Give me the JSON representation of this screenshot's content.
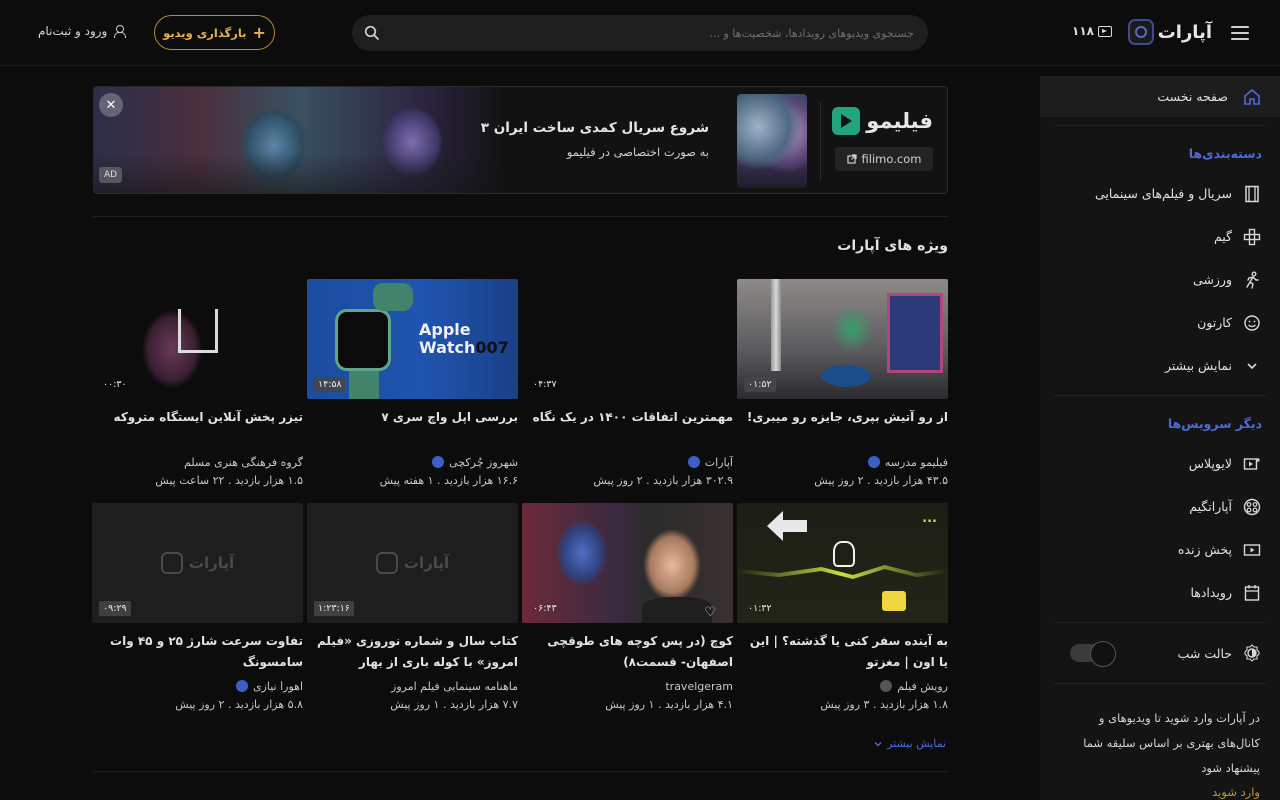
{
  "header": {
    "logo_text": "آپارات",
    "notif_count": "۱۱۸",
    "search_placeholder": "جستجوی ویدیوهای رویدادها، شخصیت‌ها و ...",
    "upload_label": "بارگذاری ویدیو",
    "login_label": "ورود و ثبت‌نام"
  },
  "banner": {
    "title": "شروع سریال کمدی ساخت ایران ۳",
    "subtitle": "به صورت اختصاصی در فیلیمو",
    "brand": "فیلیمو",
    "link": "filimo.com",
    "ad_tag": "AD",
    "close": "✕"
  },
  "sidebar": {
    "home": "صفحه نخست",
    "categories_heading": "دسته‌بندی‌ها",
    "categories": [
      {
        "label": "سریال و فیلم‌های سینمایی",
        "icon": "film-icon"
      },
      {
        "label": "گیم",
        "icon": "gamepad-icon"
      },
      {
        "label": "ورزشی",
        "icon": "runner-icon"
      },
      {
        "label": "کارتون",
        "icon": "smiley-icon"
      },
      {
        "label": "نمایش بیشتر",
        "icon": "chevron-down-icon"
      }
    ],
    "services_heading": "دیگر سرویس‌ها",
    "services": [
      {
        "label": "لایوپلاس",
        "icon": "live-plus-icon"
      },
      {
        "label": "آپاراتگیم",
        "icon": "aparat-game-icon"
      },
      {
        "label": "پخش زنده",
        "icon": "live-icon"
      },
      {
        "label": "رویدادها",
        "icon": "calendar-icon"
      }
    ],
    "night_mode": "حالت شب",
    "note": "در آپارات وارد شوید تا ویدیوهای و کانال‌های بهتری بر اساس سلیقه شما پیشنهاد شود",
    "login": "وارد شوید"
  },
  "section": {
    "title": "ویژه های آپارات",
    "more": "نمایش بیشتر"
  },
  "videos": [
    [
      {
        "title": "از رو آتیش بپری، جایزه رو میبری!",
        "channel": "فیلیمو مدرسه",
        "verified": true,
        "views": "۴۳.۵ هزار بازدید",
        "age": "۲ روز پیش",
        "duration": "۰۱:۵۲"
      },
      {
        "title": "مهمترین اتفاقات ۱۴۰۰ در یک نگاه",
        "channel": "آپارات",
        "verified": true,
        "views": "۳۰۲.۹ هزار بازدید",
        "age": "۲ روز پیش",
        "duration": "۰۴:۳۷"
      },
      {
        "title": "بررسی اپل واچ سری ۷",
        "channel": "شهروز چُرکچی",
        "verified": true,
        "views": "۱۶.۶ هزار بازدید",
        "age": "۱ هفته پیش",
        "duration": "۱۴:۵۸"
      },
      {
        "title": "تیزر پخش آنلاین ایستگاه متروکه",
        "channel": "گروه فرهنگی هنری مسلم",
        "verified": false,
        "views": "۱.۵ هزار بازدید",
        "age": "۲۲ ساعت پیش",
        "duration": "۰۰:۳۰"
      }
    ],
    [
      {
        "title": "به آینده سفر کنی یا گذشته؟ | این یا اون | مغزتو",
        "channel": "رویش فیلم",
        "verified": "gray",
        "views": "۱.۸ هزار بازدید",
        "age": "۳ روز پیش",
        "duration": "۰۱:۳۲"
      },
      {
        "title": "کوچ (در پس کوچه های طوقچی اصفهان- قسمت۸)",
        "channel": "travelgeram",
        "verified": false,
        "views": "۴.۱ هزار بازدید",
        "age": "۱ روز پیش",
        "duration": "۰۶:۴۳"
      },
      {
        "title": "کتاب سال و شماره نوروزی «فیلم امروز» با کوله باری از بهار",
        "channel": "ماهنامه سینمایی فیلم امروز",
        "verified": false,
        "views": "۷.۷ هزار بازدید",
        "age": "۱ روز پیش",
        "duration": "۱:۲۳:۱۶"
      },
      {
        "title": "تفاوت سرعت شارژ ۲۵ و ۴۵ وات سامسونگ",
        "channel": "اهورا نیازی",
        "verified": true,
        "views": "۵.۸ هزار بازدید",
        "age": "۲ روز پیش",
        "duration": "۰۹:۲۹"
      }
    ]
  ],
  "colors": {
    "accent_blue": "#4b6bd8",
    "accent_gold": "#c7932d",
    "background": "#0c0c0c",
    "sidebar": "#141414"
  }
}
